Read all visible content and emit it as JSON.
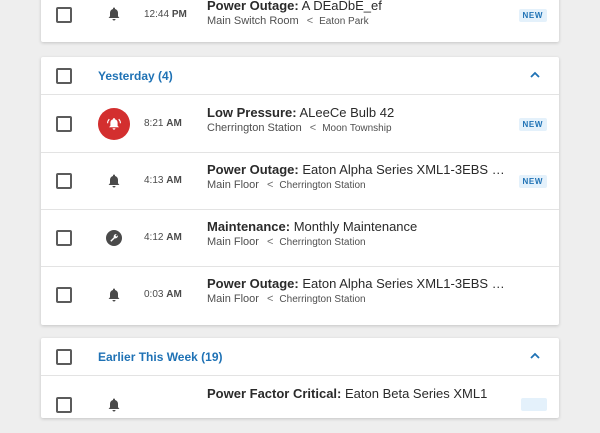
{
  "top_row": {
    "time": "12:44",
    "ampm": "PM",
    "title_bold": "Power Outage:",
    "title_rest": " A DEaDbE_ef",
    "location": "Main Switch Room",
    "separator": "<",
    "parent": "Eaton Park",
    "badge": "NEW",
    "icon": "bell-icon"
  },
  "groups": [
    {
      "title": "Yesterday (4)",
      "rows": [
        {
          "time": "8:21",
          "ampm": "AM",
          "title_bold": "Low Pressure:",
          "title_rest": " ALeeCe Bulb 42",
          "location": "Cherrington Station",
          "separator": "<",
          "parent": "Moon Township",
          "badge": "NEW",
          "icon": "alarm-bell-icon"
        },
        {
          "time": "4:13",
          "ampm": "AM",
          "title_bold": "Power Outage:",
          "title_rest": " Eaton Alpha Series XML1-3EBS Pl...",
          "location": "Main Floor",
          "separator": "<",
          "parent": "Cherrington Station",
          "badge": "NEW",
          "icon": "bell-icon"
        },
        {
          "time": "4:12",
          "ampm": "AM",
          "title_bold": "Maintenance:",
          "title_rest": " Monthly Maintenance",
          "location": "Main Floor",
          "separator": "<",
          "parent": "Cherrington Station",
          "badge": "",
          "icon": "wrench-icon"
        },
        {
          "time": "0:03",
          "ampm": "AM",
          "title_bold": "Power Outage:",
          "title_rest": " Eaton Alpha Series XML1-3EBS Pl...",
          "location": "Main Floor",
          "separator": "<",
          "parent": "Cherrington Station",
          "badge": "",
          "icon": "bell-icon"
        }
      ]
    },
    {
      "title": "Earlier This Week (19)",
      "rows": [
        {
          "title_bold": "Power Factor Critical:",
          "title_rest": " Eaton Beta Series XML1",
          "icon": "bell-icon"
        }
      ]
    }
  ],
  "colors": {
    "accent": "#1f72b5",
    "alarm": "#d32f2f",
    "badge_bg": "#e4f1fb"
  }
}
